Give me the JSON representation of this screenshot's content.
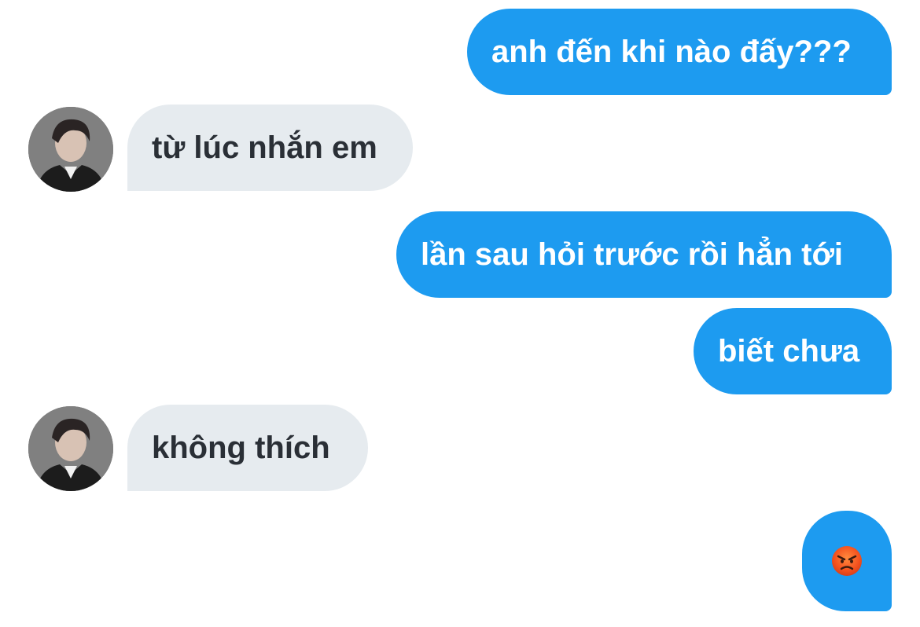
{
  "conversation": {
    "messages": [
      {
        "sender": "me",
        "text": "anh đến khi nào đấy???"
      },
      {
        "sender": "contact",
        "text": "từ lúc nhắn em"
      },
      {
        "sender": "me",
        "text": "lần sau hỏi trước rồi hẳn tới"
      },
      {
        "sender": "me",
        "text": "biết chưa"
      },
      {
        "sender": "contact",
        "text": "không thích"
      },
      {
        "sender": "me",
        "emoji": "angry-face"
      }
    ]
  },
  "colors": {
    "outgoing_bubble": "#1d9bf0",
    "incoming_bubble": "#e6ebef",
    "incoming_text": "#2a2f36",
    "outgoing_text": "#ffffff"
  },
  "icons": {
    "contact_avatar": "contact-avatar-photo",
    "emoji": "angry-face-emoji"
  }
}
